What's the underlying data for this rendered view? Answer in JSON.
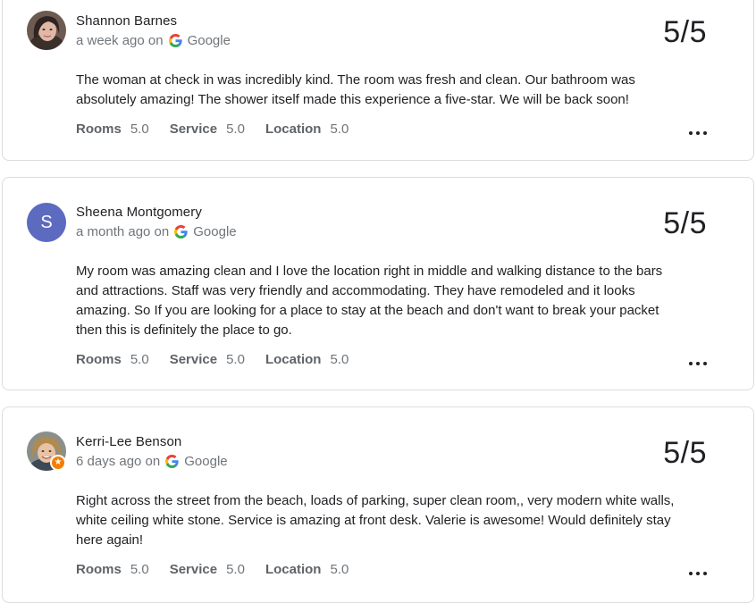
{
  "reviews": [
    {
      "name": "Shannon Barnes",
      "time": "a week ago on",
      "source": "Google",
      "score": "5/5",
      "text": "The woman at check in was incredibly kind. The room was fresh and clean. Our bathroom was absolutely amazing! The shower itself made this experience a five-star. We will be back soon!",
      "ratings": [
        {
          "label": "Rooms",
          "value": "5.0"
        },
        {
          "label": "Service",
          "value": "5.0"
        },
        {
          "label": "Location",
          "value": "5.0"
        }
      ]
    },
    {
      "name": "Sheena Montgomery",
      "avatar_letter": "S",
      "time": "a month ago on",
      "source": "Google",
      "score": "5/5",
      "text": "My room was amazing clean and I love the location right in middle and walking distance to the bars and attractions. Staff was very friendly and accommodating. They have remodeled and it looks amazing. So If you are looking for a place to stay at the beach and don't want to break your packet then this is definitely the place to go.",
      "ratings": [
        {
          "label": "Rooms",
          "value": "5.0"
        },
        {
          "label": "Service",
          "value": "5.0"
        },
        {
          "label": "Location",
          "value": "5.0"
        }
      ]
    },
    {
      "name": "Kerri-Lee Benson",
      "time": "6 days ago on",
      "source": "Google",
      "score": "5/5",
      "text": "Right across the street from the beach, loads of parking, super clean room,, very modern white walls, white ceiling white stone. Service is amazing at front desk. Valerie is awesome! Would definitely stay here again!",
      "ratings": [
        {
          "label": "Rooms",
          "value": "5.0"
        },
        {
          "label": "Service",
          "value": "5.0"
        },
        {
          "label": "Location",
          "value": "5.0"
        }
      ]
    }
  ],
  "colors": {
    "accent": "#1a73e8",
    "avatar_bg": "#5c6bc0",
    "local_guide_badge": "#f57c00"
  },
  "icons": {
    "source": "google-g-logo",
    "more": "more-horizontal-icon",
    "badge": "local-guide-star-icon"
  }
}
